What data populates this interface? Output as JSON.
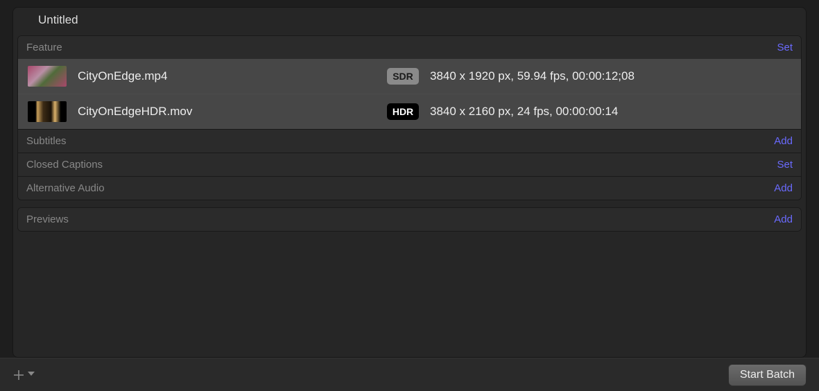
{
  "batch": {
    "title": "Untitled"
  },
  "sections": {
    "feature": {
      "label": "Feature",
      "action": "Set"
    },
    "subtitles": {
      "label": "Subtitles",
      "action": "Add"
    },
    "closed_captions": {
      "label": "Closed Captions",
      "action": "Set"
    },
    "alt_audio": {
      "label": "Alternative Audio",
      "action": "Add"
    },
    "previews": {
      "label": "Previews",
      "action": "Add"
    }
  },
  "feature_files": [
    {
      "name": "CityOnEdge.mp4",
      "dynamic_range": "SDR",
      "info": "3840 x 1920 px, 59.94 fps, 00:00:12;08"
    },
    {
      "name": "CityOnEdgeHDR.mov",
      "dynamic_range": "HDR",
      "info": "3840 x 2160 px, 24 fps, 00:00:00:14"
    }
  ],
  "footer": {
    "start_batch": "Start Batch"
  }
}
